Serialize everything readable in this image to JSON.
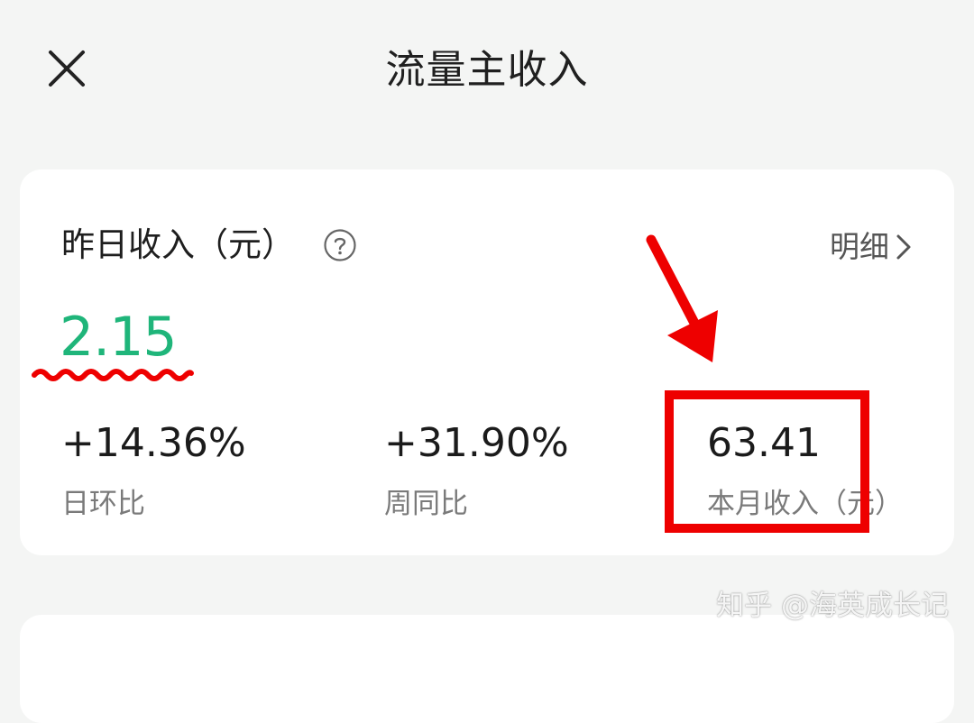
{
  "header": {
    "title": "流量主收入",
    "close_icon": "close-icon"
  },
  "income_card": {
    "label": "昨日收入（元）",
    "help_icon": "question-circle-icon",
    "detail_label": "明细",
    "detail_icon": "chevron-right-icon",
    "yesterday_value": "2.15",
    "value_color": "#1fb57a",
    "stats": [
      {
        "value": "+14.36%",
        "label": "日环比"
      },
      {
        "value": "+31.90%",
        "label": "周同比"
      },
      {
        "value": "63.41",
        "label": "本月收入（元）"
      }
    ]
  },
  "annotations": {
    "color": "#ee0000",
    "arrow_icon": "red-arrow",
    "highlight_box": "red-highlight-box",
    "underline": "red-wavy-underline"
  },
  "watermark": "知乎 @海英成长记"
}
